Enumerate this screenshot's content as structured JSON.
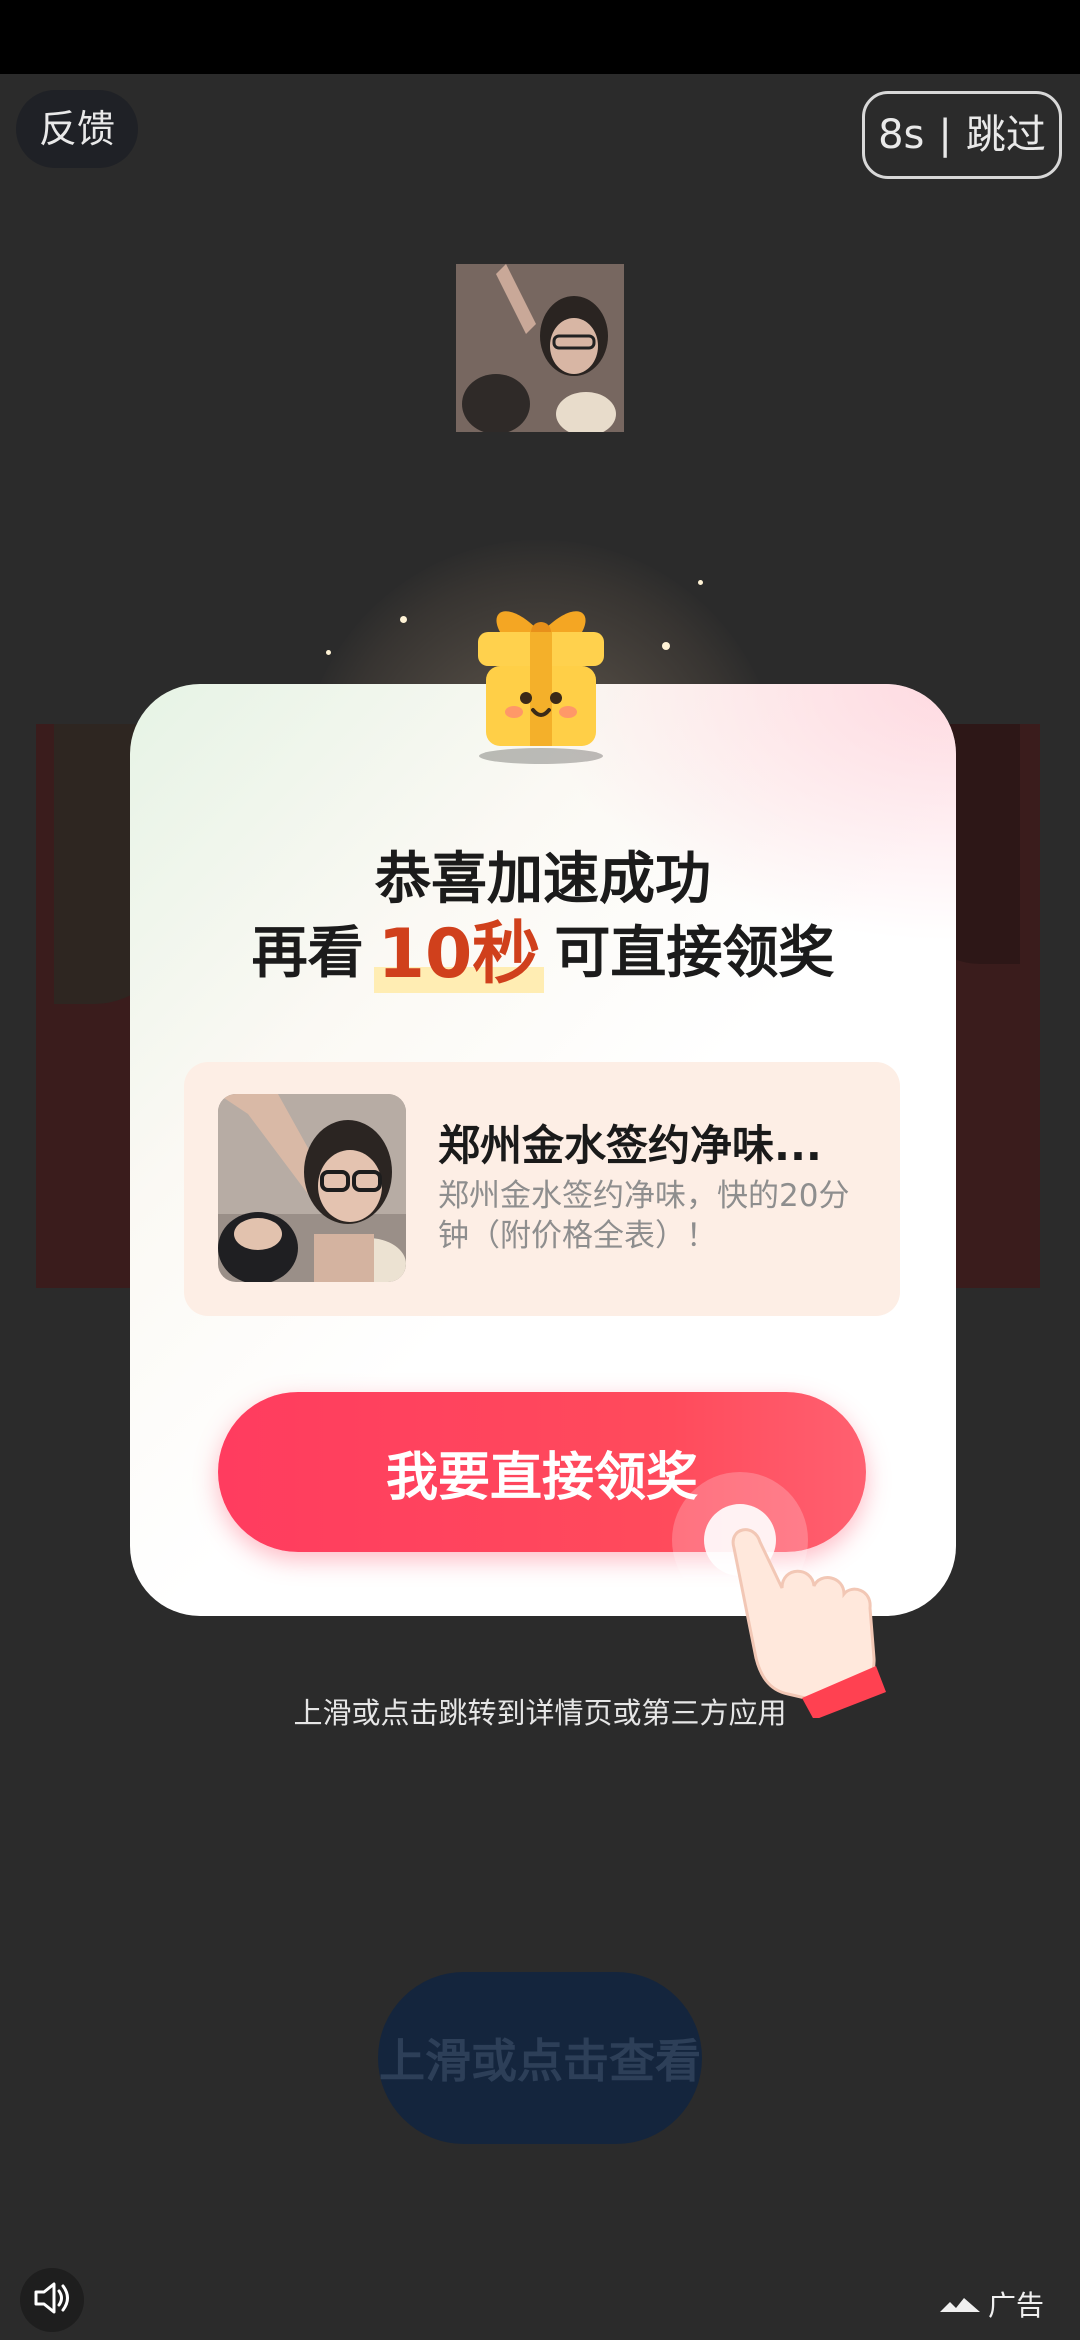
{
  "header": {
    "feedback_label": "反馈",
    "countdown": "8s",
    "skip_separator": "|",
    "skip_label": "跳过"
  },
  "modal": {
    "title_line1": "恭喜加速成功",
    "title_line2_prefix": "再看",
    "title_line2_highlight": "10秒",
    "title_line2_suffix": "可直接领奖",
    "card": {
      "title": "郑州金水签约净味...",
      "description": "郑州金水签约净味，快的20分钟（附价格全表）！"
    },
    "cta_label": "我要直接领奖"
  },
  "hint_text": "上滑或点击跳转到详情页或第三方应用",
  "bottom_button_label": "上滑或点击查看",
  "ad_label": "广告",
  "colors": {
    "background": "#2b2b2b",
    "cta": "#ff4b5c",
    "highlight": "#d0401c",
    "card_bg": "#fdeee5"
  },
  "icons": [
    "gift-icon",
    "hand-pointer-icon",
    "sound-icon",
    "ad-logo-icon"
  ]
}
